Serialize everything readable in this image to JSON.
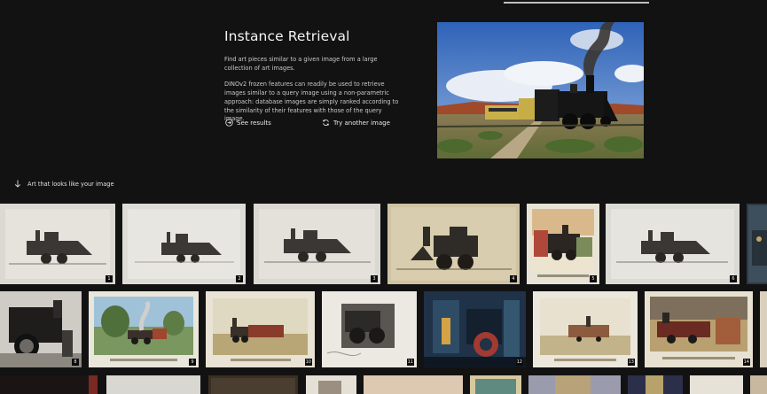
{
  "intro": {
    "title": "Instance Retrieval",
    "paragraph_1": "Find art pieces similar to a given image from a large collection of art images.",
    "paragraph_2": "DINOv2 frozen features can readily be used to retrieve images similar to a query image using a non-parametric approach: database images are simply ranked according to the similarity of their features with those of the query image."
  },
  "actions": {
    "see_results": "See results",
    "try_another": "Try another image"
  },
  "results": {
    "label": "Art that looks like your image",
    "ranks": [
      "1",
      "2",
      "3",
      "4",
      "5",
      "6",
      "8",
      "9",
      "10",
      "11",
      "12",
      "13",
      "14"
    ]
  },
  "colors": {
    "background": "#121212",
    "text": "#e8e8e8",
    "muted_text": "#c9c9c9",
    "rank_badge": "#0c0c0c"
  },
  "icons": {
    "see_results": "arrow-circle-icon",
    "try_another": "refresh-icon",
    "section": "arrow-down-icon"
  }
}
